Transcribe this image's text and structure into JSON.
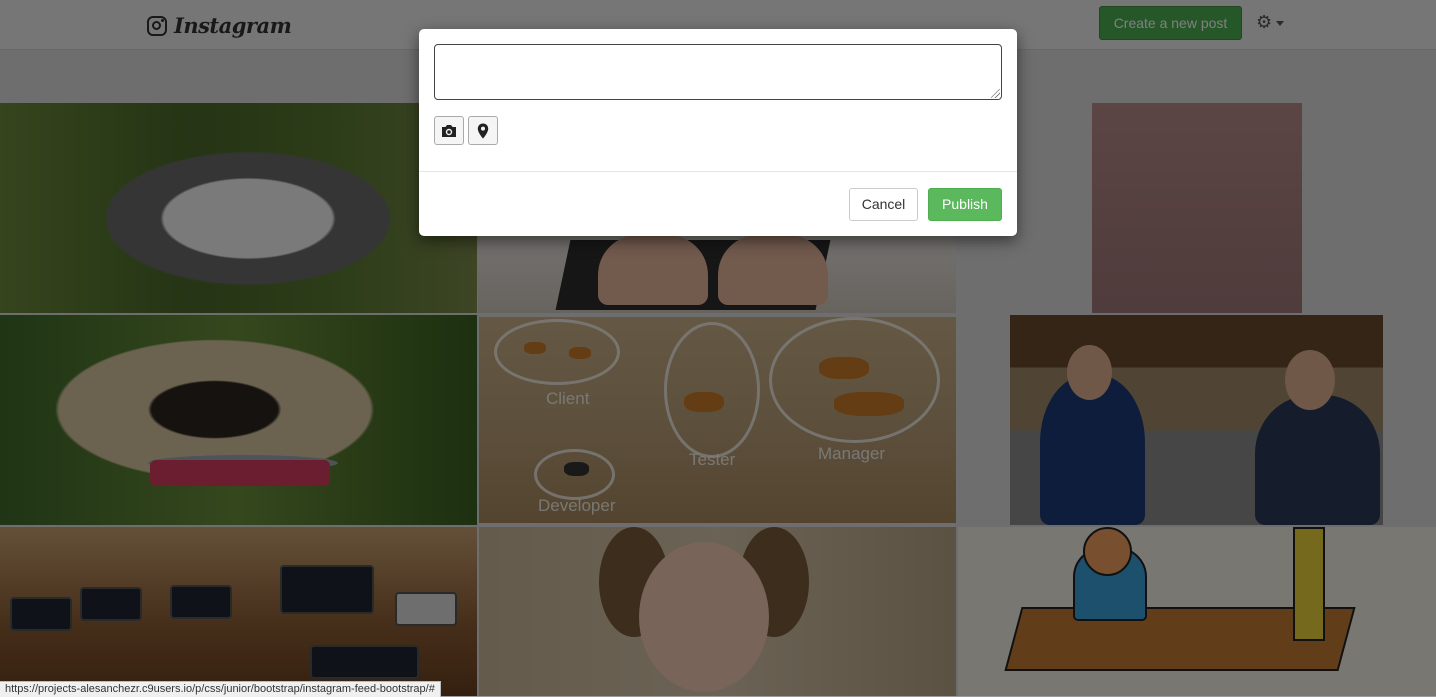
{
  "navbar": {
    "brand_name": "Instagram",
    "brand_icon": "instagram-camera-icon",
    "new_post_label": "Create a new post",
    "settings_icon": "gear-icon",
    "accent_color": "#4caf50"
  },
  "feed": {
    "tiles": [
      {
        "subject": "husky-puppy-photo"
      },
      {
        "subject": "laptop-typing-photo"
      },
      {
        "subject": "pink-wall-photo"
      },
      {
        "subject": "pug-photo"
      },
      {
        "subject": "tigers-diagram-photo"
      },
      {
        "subject": "two-people-talking-photo"
      },
      {
        "subject": "phones-charging-photo"
      },
      {
        "subject": "girl-pigtails-photo"
      },
      {
        "subject": "office-cartoon"
      }
    ],
    "tiger_labels": {
      "client": "Client",
      "tester": "Tester",
      "manager": "Manager",
      "developer": "Developer"
    }
  },
  "modal": {
    "textarea_value": "",
    "camera_icon": "camera-icon",
    "location_icon": "map-marker-icon",
    "cancel_label": "Cancel",
    "publish_label": "Publish",
    "publish_color": "#5cb85c"
  },
  "status_bar": {
    "url": "https://projects-alesanchezr.c9users.io/p/css/junior/bootstrap/instagram-feed-bootstrap/#"
  }
}
